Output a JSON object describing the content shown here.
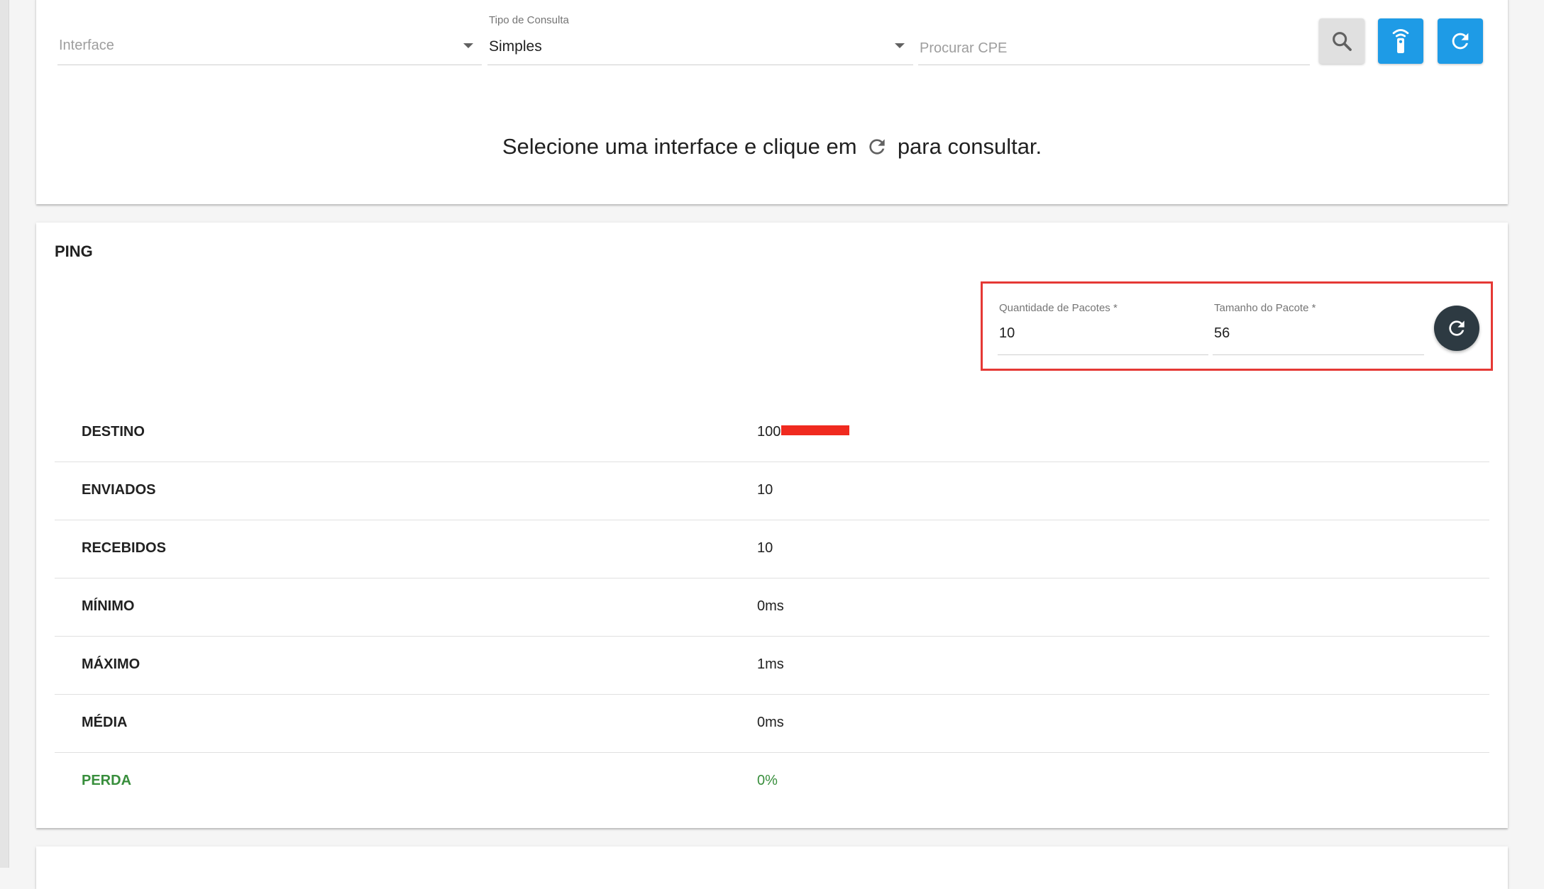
{
  "filters": {
    "interface": {
      "label": "",
      "placeholder": "Interface"
    },
    "tipo_consulta": {
      "label": "Tipo de Consulta",
      "value": "Simples"
    },
    "procurar_cpe": {
      "placeholder": "Procurar CPE"
    }
  },
  "toolbar": {
    "search_icon": "search-icon",
    "remote_icon": "remote-control-icon",
    "refresh_icon": "refresh-icon"
  },
  "hint": {
    "before": "Selecione uma interface e clique em",
    "after": "para consultar."
  },
  "ping": {
    "title": "PING",
    "quantidade": {
      "label": "Quantidade de Pacotes *",
      "value": "10"
    },
    "tamanho": {
      "label": "Tamanho do Pacote *",
      "value": "56"
    },
    "rows": [
      {
        "label": "DESTINO",
        "value": "100"
      },
      {
        "label": "ENVIADOS",
        "value": "10"
      },
      {
        "label": "RECEBIDOS",
        "value": "10"
      },
      {
        "label": "MÍNIMO",
        "value": "0ms"
      },
      {
        "label": "MÁXIMO",
        "value": "1ms"
      },
      {
        "label": "MÉDIA",
        "value": "0ms"
      },
      {
        "label": "PERDA",
        "value": "0%"
      }
    ]
  },
  "colors": {
    "primary": "#1e9be6",
    "dark_button": "#2d3a42",
    "success": "#388e3c",
    "highlight": "#e53935"
  }
}
